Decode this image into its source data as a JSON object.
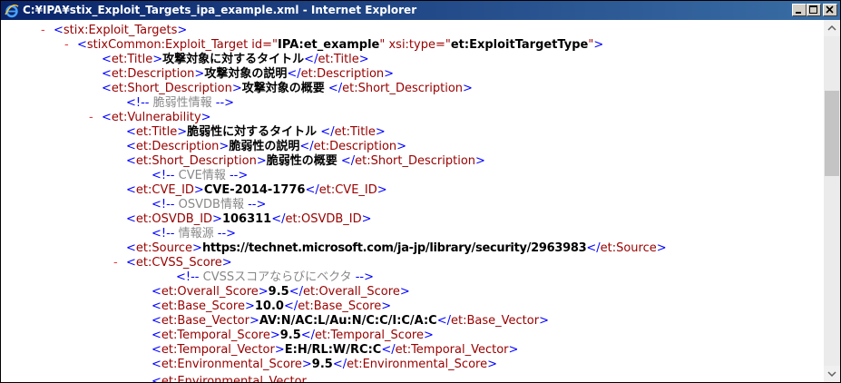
{
  "window": {
    "title": "C:¥IPA¥stix_Exploit_Targets_ipa_example.xml - Internet Explorer"
  },
  "icons": {
    "app": "internet-explorer-icon",
    "minimize": "minimize-icon",
    "maximize": "maximize-icon",
    "close": "close-icon",
    "up": "scroll-up-arrow-icon",
    "down": "scroll-down-arrow-icon"
  },
  "xml": {
    "l1": {
      "marker": "-",
      "open": "<",
      "name": "stix:Exploit_Targets",
      "close": ">"
    },
    "l2": {
      "marker": "-",
      "open": "<",
      "name": "stixCommon:Exploit_Target",
      "attr1_name": " id=\"",
      "attr1_value": "IPA:et_example",
      "attr1_end": "\"",
      "attr2_name": " xsi:type=\"",
      "attr2_value": "et:ExploitTargetType",
      "attr2_end": "\"",
      "close": ">"
    },
    "l3": {
      "open": "<",
      "name": "et:Title",
      "gt": ">",
      "text": "攻撃対象に対するタイトル",
      "end_open": "</",
      "end_name": "et:Title",
      "end_gt": ">"
    },
    "l4": {
      "open": "<",
      "name": "et:Description",
      "gt": ">",
      "text": "攻撃対象の説明",
      "end_open": "</",
      "end_name": "et:Description",
      "end_gt": ">"
    },
    "l5": {
      "open": "<",
      "name": "et:Short_Description",
      "gt": ">",
      "text": "攻撃対象の概要",
      "end_open": " </",
      "end_name": "et:Short_Description",
      "end_gt": ">"
    },
    "l6": {
      "c_open": "<!--",
      "c_text": " 脆弱性情報 ",
      "c_close": "-->"
    },
    "l7": {
      "marker": "-",
      "open": "<",
      "name": "et:Vulnerability",
      "close": ">"
    },
    "l8": {
      "open": "<",
      "name": "et:Title",
      "gt": ">",
      "text": "脆弱性に対するタイトル",
      "end_open": " </",
      "end_name": "et:Title",
      "end_gt": ">"
    },
    "l9": {
      "open": "<",
      "name": "et:Description",
      "gt": ">",
      "text": "脆弱性の説明",
      "end_open": "</",
      "end_name": "et:Description",
      "end_gt": ">"
    },
    "l10": {
      "open": "<",
      "name": "et:Short_Description",
      "gt": ">",
      "text": "脆弱性の概要",
      "end_open": " </",
      "end_name": "et:Short_Description",
      "end_gt": ">"
    },
    "l11": {
      "c_open": "<!--",
      "c_text": " CVE情報 ",
      "c_close": "-->"
    },
    "l12": {
      "open": "<",
      "name": "et:CVE_ID",
      "gt": ">",
      "text": "CVE-2014-1776",
      "end_open": "</",
      "end_name": "et:CVE_ID",
      "end_gt": ">"
    },
    "l13": {
      "c_open": "<!--",
      "c_text": " OSVDB情報 ",
      "c_close": "-->"
    },
    "l14": {
      "open": "<",
      "name": "et:OSVDB_ID",
      "gt": ">",
      "text": "106311",
      "end_open": "</",
      "end_name": "et:OSVDB_ID",
      "end_gt": ">"
    },
    "l15": {
      "c_open": "<!--",
      "c_text": " 情報源 ",
      "c_close": "-->"
    },
    "l16": {
      "open": "<",
      "name": "et:Source",
      "gt": ">",
      "text": "https://technet.microsoft.com/ja-jp/library/security/2963983",
      "end_open": "</",
      "end_name": "et:Source",
      "end_gt": ">"
    },
    "l17": {
      "marker": "-",
      "open": "<",
      "name": "et:CVSS_Score",
      "close": ">"
    },
    "l18": {
      "c_open": "<!--",
      "c_text": " CVSSスコアならびにベクタ ",
      "c_close": "-->"
    },
    "l19": {
      "open": "<",
      "name": "et:Overall_Score",
      "gt": ">",
      "text": "9.5",
      "end_open": "</",
      "end_name": "et:Overall_Score",
      "end_gt": ">"
    },
    "l20": {
      "open": "<",
      "name": "et:Base_Score",
      "gt": ">",
      "text": "10.0",
      "end_open": "</",
      "end_name": "et:Base_Score",
      "end_gt": ">"
    },
    "l21": {
      "open": "<",
      "name": "et:Base_Vector",
      "gt": ">",
      "text": "AV:N/AC:L/Au:N/C:C/I:C/A:C",
      "end_open": "</",
      "end_name": "et:Base_Vector",
      "end_gt": ">"
    },
    "l22": {
      "open": "<",
      "name": "et:Temporal_Score",
      "gt": ">",
      "text": "9.5",
      "end_open": "</",
      "end_name": "et:Temporal_Score",
      "end_gt": ">"
    },
    "l23": {
      "open": "<",
      "name": "et:Temporal_Vector",
      "gt": ">",
      "text": "E:H/RL:W/RC:C",
      "end_open": "</",
      "end_name": "et:Temporal_Vector",
      "end_gt": ">"
    },
    "l24": {
      "open": "<",
      "name": "et:Environmental_Score",
      "gt": ">",
      "text": "9.5",
      "end_open": "</",
      "end_name": "et:Environmental_Score",
      "end_gt": ">"
    }
  }
}
